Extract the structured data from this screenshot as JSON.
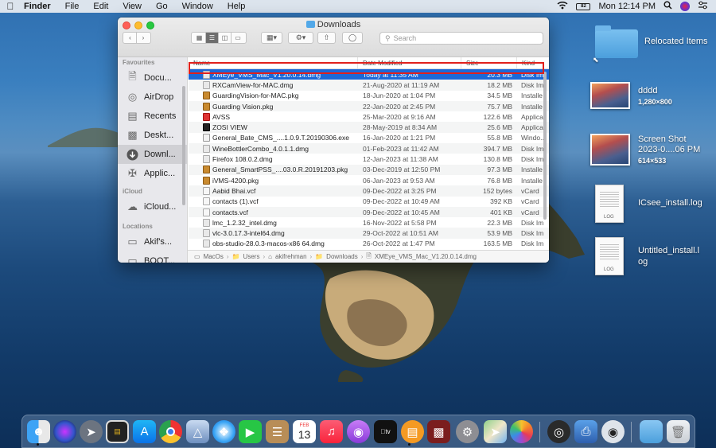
{
  "menubar": {
    "app": "Finder",
    "items": [
      "File",
      "Edit",
      "View",
      "Go",
      "Window",
      "Help"
    ],
    "clock": "Mon 12:14 PM",
    "battery": "82"
  },
  "window": {
    "title": "Downloads",
    "search_placeholder": "Search",
    "columns": {
      "name": "Name",
      "date": "Date Modified",
      "size": "Size",
      "kind": "Kind"
    }
  },
  "sidebar": {
    "favourites_heading": "Favourites",
    "icloud_heading": "iCloud",
    "locations_heading": "Locations",
    "favourites": [
      "Docu...",
      "AirDrop",
      "Recents",
      "Deskt...",
      "Downl...",
      "Applic..."
    ],
    "icloud": [
      "iCloud..."
    ],
    "locations": [
      "Akif's...",
      "BOOT..."
    ]
  },
  "files": [
    {
      "name": "XMEye_VMS_Mac_V1.20.0.14.dmg",
      "date": "Today at 11:35 AM",
      "size": "20.3 MB",
      "kind": "Disk Im",
      "icon": "dmg"
    },
    {
      "name": "RXCamView-for-MAC.dmg",
      "date": "21-Aug-2020 at 11:19 AM",
      "size": "18.2 MB",
      "kind": "Disk Im",
      "icon": "dmg"
    },
    {
      "name": "GuardingVision-for-MAC.pkg",
      "date": "18-Jun-2020 at 1:04 PM",
      "size": "34.5 MB",
      "kind": "Installe",
      "icon": "pkg"
    },
    {
      "name": "Guarding Vision.pkg",
      "date": "22-Jan-2020 at 2:45 PM",
      "size": "75.7 MB",
      "kind": "Installe",
      "icon": "pkg"
    },
    {
      "name": "AVSS",
      "date": "25-Mar-2020 at 9:16 AM",
      "size": "122.6 MB",
      "kind": "Applica",
      "icon": "app"
    },
    {
      "name": "ZOSI VIEW",
      "date": "28-May-2019 at 8:34 AM",
      "size": "25.6 MB",
      "kind": "Applica",
      "icon": "app2"
    },
    {
      "name": "General_Bate_CMS_....1.0.9.T.20190306.exe",
      "date": "16-Jan-2020 at 1:21 PM",
      "size": "55.8 MB",
      "kind": "Windo...",
      "icon": "exe"
    },
    {
      "name": "WineBottlerCombo_4.0.1.1.dmg",
      "date": "01-Feb-2023 at 11:42 AM",
      "size": "394.7 MB",
      "kind": "Disk Im",
      "icon": "dmg"
    },
    {
      "name": "Firefox 108.0.2.dmg",
      "date": "12-Jan-2023 at 11:38 AM",
      "size": "130.8 MB",
      "kind": "Disk Im",
      "icon": "dmg"
    },
    {
      "name": "General_SmartPSS_....03.0.R.20191203.pkg",
      "date": "03-Dec-2019 at 12:50 PM",
      "size": "97.3 MB",
      "kind": "Installe",
      "icon": "pkg"
    },
    {
      "name": "iVMS-4200.pkg",
      "date": "06-Jan-2023 at 9:53 AM",
      "size": "76.8 MB",
      "kind": "Installe",
      "icon": "pkg"
    },
    {
      "name": "Aabid Bhai.vcf",
      "date": "09-Dec-2022 at 3:25 PM",
      "size": "152 bytes",
      "kind": "vCard",
      "icon": "vcf"
    },
    {
      "name": "contacts (1).vcf",
      "date": "09-Dec-2022 at 10:49 AM",
      "size": "392 KB",
      "kind": "vCard",
      "icon": "vcf"
    },
    {
      "name": "contacts.vcf",
      "date": "09-Dec-2022 at 10:45 AM",
      "size": "401 KB",
      "kind": "vCard",
      "icon": "vcf"
    },
    {
      "name": "lmc_1.2.32_intel.dmg",
      "date": "16-Nov-2022 at 5:58 PM",
      "size": "22.3 MB",
      "kind": "Disk Im",
      "icon": "dmg"
    },
    {
      "name": "vlc-3.0.17.3-intel64.dmg",
      "date": "29-Oct-2022 at 10:51 AM",
      "size": "53.9 MB",
      "kind": "Disk Im",
      "icon": "dmg"
    },
    {
      "name": "obs-studio-28.0.3-macos-x86 64.dmg",
      "date": "26-Oct-2022 at 1:47 PM",
      "size": "163.5 MB",
      "kind": "Disk Im",
      "icon": "dmg"
    }
  ],
  "pathbar": [
    "MacOs",
    "Users",
    "akifrehman",
    "Downloads",
    "XMEye_VMS_Mac_V1.20.0.14.dmg"
  ],
  "desktop": {
    "relocated": "Relocated Items",
    "dddd_name": "dddd",
    "dddd_dims": "1,280×800",
    "screenshot_name_1": "Screen Shot",
    "screenshot_name_2": "2023-0....06 PM",
    "screenshot_dims": "614×533",
    "log1_name": "ICsee_install.log",
    "log2_name_1": "Untitled_install.l",
    "log2_name_2": "og",
    "log_tag": "LOG"
  },
  "dock": {
    "apps": [
      "finder-icon",
      "siri-icon",
      "launchpad-icon",
      "terminal-icon",
      "app-store-icon",
      "chrome-icon",
      "preview-icon",
      "safari-icon",
      "facetime-icon",
      "notes-icon",
      "calendar-icon",
      "music-icon",
      "podcasts-icon",
      "apple-tv-icon",
      "books-icon",
      "photo-booth-icon",
      "system-preferences-icon",
      "maps-icon",
      "photos-icon",
      "obs-icon",
      "printer-icon",
      "camera-app-icon",
      "downloads-folder-icon",
      "trash-icon"
    ],
    "calendar_month": "FEB",
    "calendar_day": "13"
  }
}
